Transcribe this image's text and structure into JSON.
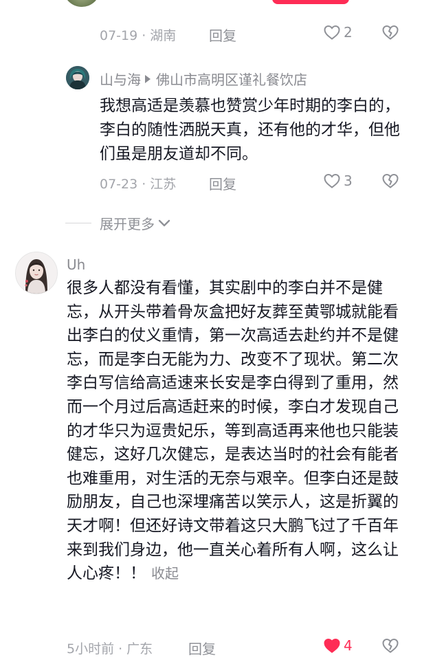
{
  "comment_top": {
    "date": "07-19",
    "location": "湖南",
    "reply_label": "回复",
    "like_count": "2"
  },
  "reply_comment": {
    "username": "山与海",
    "reply_to": "佛山市高明区谨礼餐饮店",
    "text": "我想高适是羡慕也赞赏少年时期的李白的，李白的随性洒脱天真，还有他的才华，但他们虽是朋友道却不同。",
    "date": "07-23",
    "location": "江苏",
    "reply_label": "回复",
    "like_count": "3"
  },
  "expand_more_label": "展开更多",
  "main_comment": {
    "username": "Uh",
    "text": "很多人都没有看懂，其实剧中的李白并不是健忘，从开头带着骨灰盒把好友葬至黄鄂城就能看出李白的仗义重情，第一次高适去赴约并不是健忘，而是李白无能为力、改变不了现状。第二次李白写信给高适速来长安是李白得到了重用，然而一个月过后高适赶来的时候，李白才发现自己的才华只为逗贵妃乐，等到高适再来他也只能装健忘，这好几次健忘，是表达当时的社会有能者也难重用，对生活的无奈与艰辛。但李白还是鼓励朋友，自己也深埋痛苦以笑示人，这是折翼的天才啊！但还好诗文带着这只大鹏飞过了千百年来到我们身边，他一直关心着所有人啊，这么让人心疼！！",
    "collapse_label": "收起",
    "time": "5小时前",
    "location": "广东",
    "reply_label": "回复",
    "like_count": "4",
    "liked_color": "#fe2c55"
  },
  "icons": {
    "like": "heart-outline-icon",
    "liked": "heart-filled-icon",
    "dislike": "broken-heart-icon",
    "expand": "chevron-down-icon",
    "reply_arrow": "triangle-right-icon"
  }
}
